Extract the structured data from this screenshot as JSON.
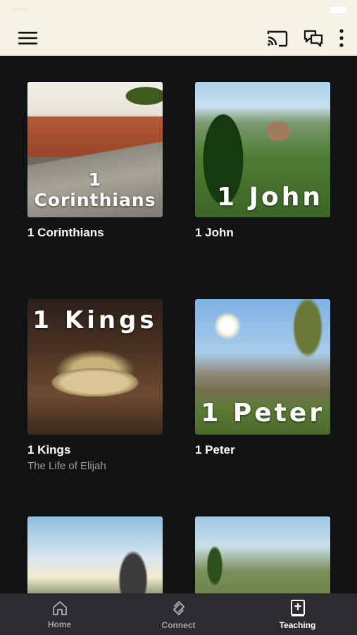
{
  "status_bar": {
    "carrier": "•••••• ",
    "time": ""
  },
  "app_bar": {
    "menu_icon": "menu-icon",
    "cast_icon": "cast-icon",
    "chat_icon": "chat-icon",
    "more_icon": "more-vertical-icon"
  },
  "cards": [
    {
      "title": "1 Corinthians",
      "image_text": "1 Corinthians",
      "subtitle": ""
    },
    {
      "title": "1 John",
      "image_text": "1 John",
      "subtitle": ""
    },
    {
      "title": "1 Kings",
      "image_text": "1 Kings",
      "subtitle": "The Life of Elijah"
    },
    {
      "title": "1 Peter",
      "image_text": "1 Peter",
      "subtitle": ""
    },
    {
      "title": "",
      "image_text": "",
      "subtitle": ""
    },
    {
      "title": "",
      "image_text": "",
      "subtitle": ""
    }
  ],
  "bottom_nav": [
    {
      "label": "Home",
      "icon": "home-icon",
      "active": false
    },
    {
      "label": "Connect",
      "icon": "connect-icon",
      "active": false
    },
    {
      "label": "Teaching",
      "icon": "bible-icon",
      "active": true
    }
  ],
  "colors": {
    "background": "#111214",
    "app_bar": "#f6f3e6",
    "bottom_nav": "#2b2c2f",
    "subtitle": "#9c9ea3"
  }
}
